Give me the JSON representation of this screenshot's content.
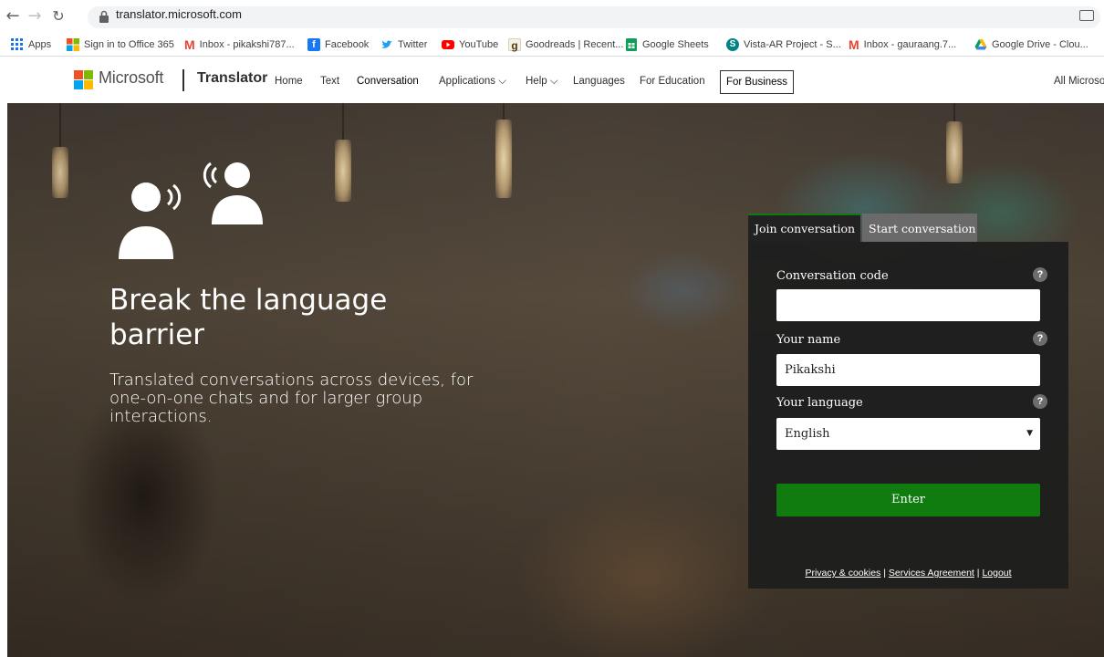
{
  "browser": {
    "url": "translator.microsoft.com"
  },
  "bookmarks": [
    {
      "label": "Apps",
      "icon": "apps-grid-icon",
      "color": "#1a73e8"
    },
    {
      "label": "Sign in to Office 365",
      "icon": "office-icon",
      "color": "#d83b01"
    },
    {
      "label": "Inbox - pikakshi787...",
      "icon": "gmail-icon",
      "color": "#ea4335"
    },
    {
      "label": "Facebook",
      "icon": "facebook-icon",
      "color": "#1877f2"
    },
    {
      "label": "Twitter",
      "icon": "twitter-icon",
      "color": "#1da1f2"
    },
    {
      "label": "YouTube",
      "icon": "youtube-icon",
      "color": "#ff0000"
    },
    {
      "label": "Goodreads | Recent...",
      "icon": "goodreads-icon",
      "color": "#b57a2a"
    },
    {
      "label": "Google Sheets",
      "icon": "sheets-icon",
      "color": "#0f9d58"
    },
    {
      "label": "Vista-AR Project - S...",
      "icon": "sharepoint-icon",
      "color": "#038387"
    },
    {
      "label": "Inbox - gauraang.7...",
      "icon": "gmail-icon",
      "color": "#ea4335"
    },
    {
      "label": "Google Drive - Clou...",
      "icon": "drive-icon",
      "color": "#fbbc04"
    }
  ],
  "header": {
    "brand": "Microsoft",
    "product": "Translator",
    "nav": [
      {
        "label": "Home"
      },
      {
        "label": "Text"
      },
      {
        "label": "Conversation"
      },
      {
        "label": "Applications ⌵"
      },
      {
        "label": "Help ⌵"
      },
      {
        "label": "Languages"
      },
      {
        "label": "For Education"
      }
    ],
    "business_button": "For Business",
    "all_microsoft": "All Microso"
  },
  "hero": {
    "title": "Break the language barrier",
    "subtitle": "Translated conversations across devices, for one-on-one chats and for larger group interactions."
  },
  "panel": {
    "tabs": [
      {
        "label": "Join conversation",
        "active": true
      },
      {
        "label": "Start conversation",
        "active": false
      }
    ],
    "code_label": "Conversation code",
    "code_value": "",
    "name_label": "Your name",
    "name_value": "Pikakshi",
    "language_label": "Your language",
    "language_value": "English",
    "help_mark": "?",
    "enter_label": "Enter",
    "footer": {
      "privacy": "Privacy & cookies",
      "separator": "|",
      "services": "Services Agreement",
      "logout": "Logout"
    }
  },
  "colors": {
    "accent_green": "#107c10",
    "panel_bg": "#1e1e1e",
    "inactive_tab": "#6a6a6a"
  }
}
